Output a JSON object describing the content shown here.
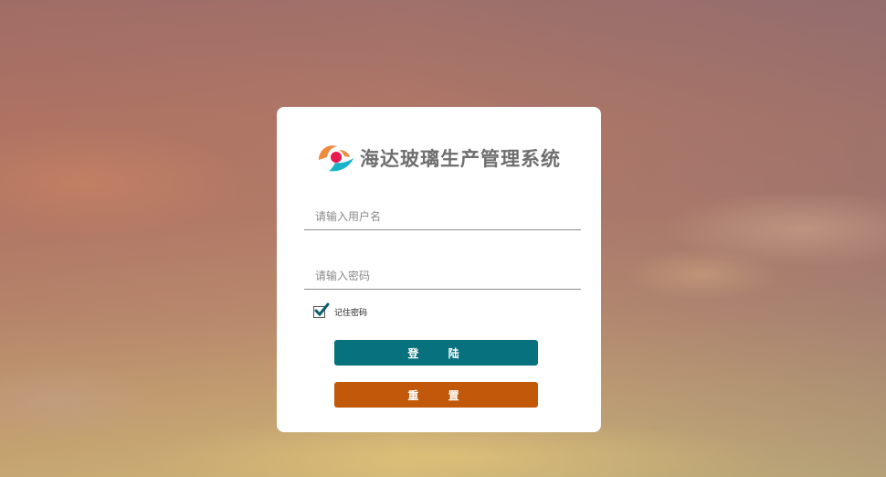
{
  "app": {
    "title": "海达玻璃生产管理系统",
    "logo_icon": "haida-logo-icon"
  },
  "form": {
    "username": {
      "value": "",
      "placeholder": "请输入用户名"
    },
    "password": {
      "value": "",
      "placeholder": "请输入密码"
    },
    "remember": {
      "label": "记住密码",
      "checked": true
    },
    "login_label": "登 陆",
    "reset_label": "重 置"
  },
  "colors": {
    "login_button": "#07727e",
    "reset_button": "#c2590a",
    "logo_orange": "#f08a3c",
    "logo_red": "#e8174f",
    "logo_cyan": "#19b3c7"
  }
}
